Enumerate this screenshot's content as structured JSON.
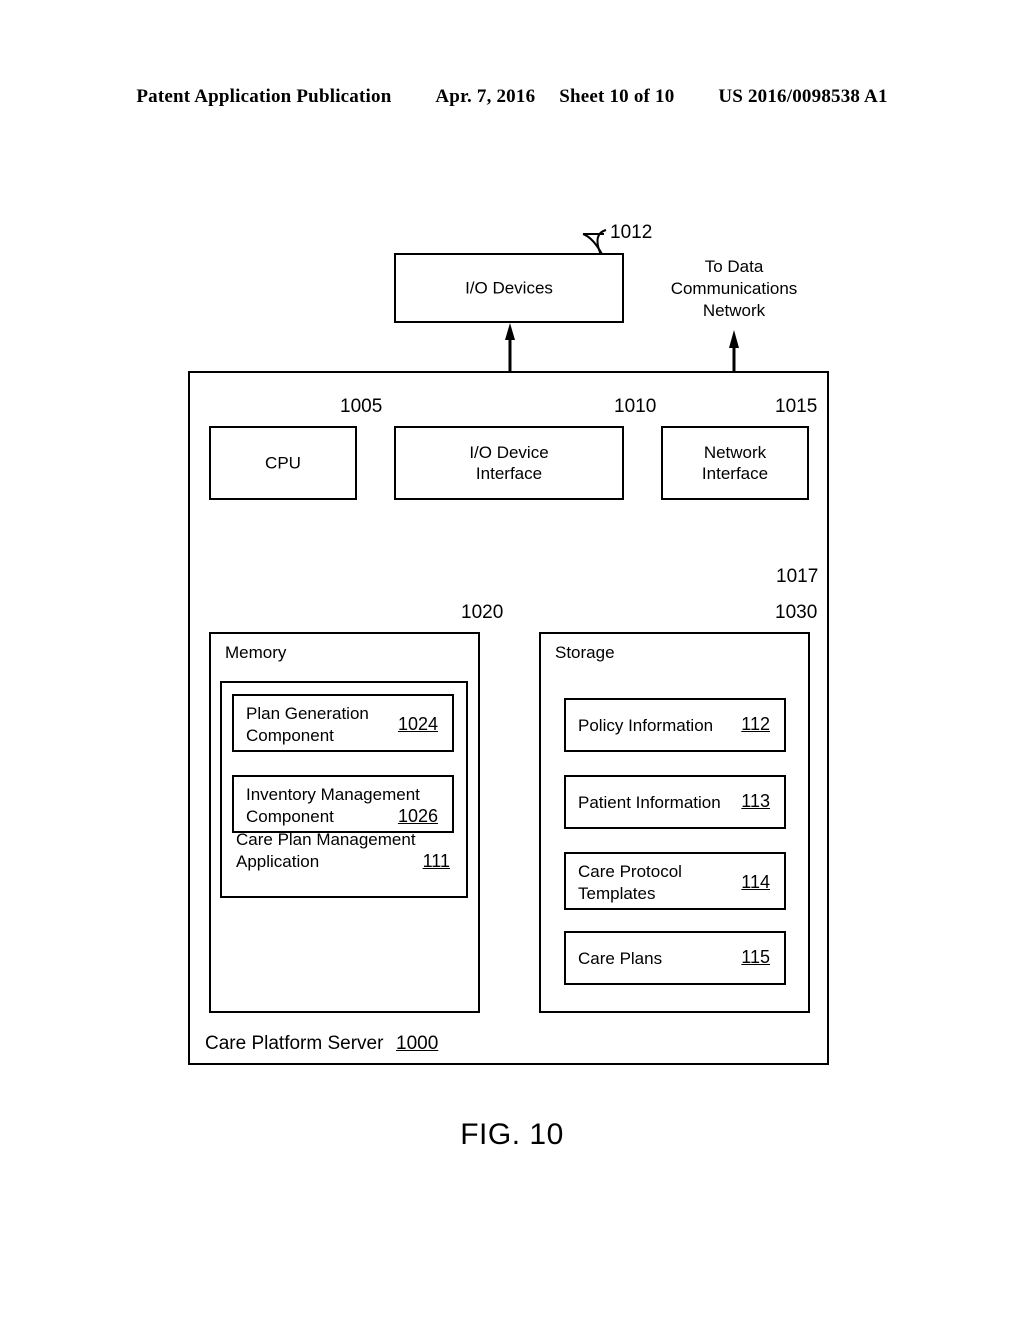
{
  "header": {
    "publication": "Patent Application Publication",
    "date": "Apr. 7, 2016",
    "sheet": "Sheet 10 of 10",
    "docnum": "US 2016/0098538 A1"
  },
  "figure": {
    "caption": "FIG. 10"
  },
  "diagram": {
    "io_devices": {
      "label": "I/O Devices",
      "ref": "1012"
    },
    "network_note": {
      "line1": "To Data",
      "line2": "Communications",
      "line3": "Network"
    },
    "cpu": {
      "label": "CPU",
      "ref": "1005"
    },
    "io_interface": {
      "label": "I/O Device\nInterface",
      "ref": "1010"
    },
    "network_interface": {
      "label": "Network\nInterface",
      "ref": "1015"
    },
    "bus": {
      "ref": "1017"
    },
    "memory": {
      "title": "Memory",
      "ref": "1020",
      "application": {
        "title": "Care Plan Management\nApplication",
        "num": "111"
      },
      "components": [
        {
          "label": "Plan Generation\nComponent",
          "num": "1024"
        },
        {
          "label": "Inventory Management\nComponent",
          "num": "1026"
        }
      ]
    },
    "storage": {
      "title": "Storage",
      "ref": "1030",
      "items": [
        {
          "label": "Policy Information",
          "num": "112"
        },
        {
          "label": "Patient Information",
          "num": "113"
        },
        {
          "label": "Care Protocol\nTemplates",
          "num": "114"
        },
        {
          "label": "Care Plans",
          "num": "115"
        }
      ]
    },
    "server": {
      "label": "Care Platform Server",
      "num": "1000"
    }
  }
}
